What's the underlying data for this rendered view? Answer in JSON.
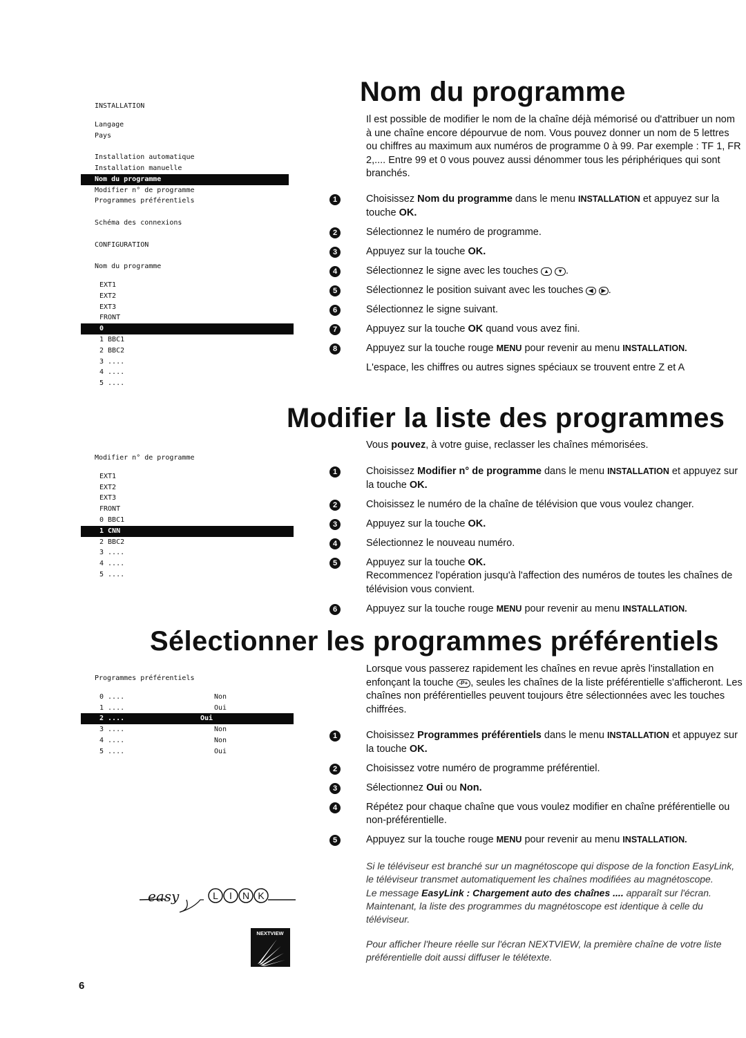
{
  "page_number": "6",
  "menus": [
    {
      "lines": [
        {
          "t": "INSTALLATION"
        },
        {
          "t": "Langage",
          "gap": "gap2"
        },
        {
          "t": "Pays"
        },
        {
          "t": "Installation automatique",
          "gap": "gap"
        },
        {
          "t": "Installation manuelle"
        },
        {
          "t": "Nom du programme",
          "hl": true
        },
        {
          "t": "Modifier n° de programme"
        },
        {
          "t": "Programmes préférentiels"
        },
        {
          "t": "Schéma des connexions",
          "gap": "gap"
        },
        {
          "t": "CONFIGURATION",
          "gap": "gap"
        },
        {
          "t": "Nom du programme",
          "gap": "gap"
        },
        {
          "t": "EXT1",
          "ind": true,
          "gap": "gap2"
        },
        {
          "t": "EXT2",
          "ind": true
        },
        {
          "t": "EXT3",
          "ind": true
        },
        {
          "t": "FRONT",
          "ind": true
        },
        {
          "t": "0",
          "ind": true,
          "hl": true
        },
        {
          "t": "1 BBC1",
          "ind": true
        },
        {
          "t": "2 BBC2",
          "ind": true
        },
        {
          "t": "3 ....",
          "ind": true
        },
        {
          "t": "4 ....",
          "ind": true
        },
        {
          "t": "5 ....",
          "ind": true
        }
      ]
    },
    {
      "lines": [
        {
          "t": "Modifier n° de programme"
        },
        {
          "t": "EXT1",
          "ind": true,
          "gap": "gap2"
        },
        {
          "t": "EXT2",
          "ind": true
        },
        {
          "t": "EXT3",
          "ind": true
        },
        {
          "t": "FRONT",
          "ind": true
        },
        {
          "t": "0 BBC1",
          "ind": true
        },
        {
          "t": "1 CNN",
          "ind": true,
          "hl": true
        },
        {
          "t": "2 BBC2",
          "ind": true
        },
        {
          "t": "3 ....",
          "ind": true
        },
        {
          "t": "4 ....",
          "ind": true
        },
        {
          "t": "5 ....",
          "ind": true
        }
      ]
    },
    {
      "lines": [
        {
          "t": "Programmes préférentiels"
        },
        {
          "t": "0 ....",
          "v": "Non",
          "ind": true,
          "gap": "gap2"
        },
        {
          "t": "1 ....",
          "v": "Oui",
          "ind": true
        },
        {
          "t": "2 ....",
          "v": "Oui",
          "ind": true,
          "hl": true
        },
        {
          "t": "3 ....",
          "v": "Non",
          "ind": true
        },
        {
          "t": "4 ....",
          "v": "Non",
          "ind": true
        },
        {
          "t": "5 ....",
          "v": "Oui",
          "ind": true
        }
      ]
    }
  ],
  "sections": [
    {
      "title": "Nom du programme",
      "intro": [
        [
          {
            "t": "Il est possible de modifier le nom de la chaîne déjà mémorisé ou d'attribuer un nom à une chaîne encore dépourvue de nom. Vous pouvez donner un nom de 5 lettres ou chiffres au maximum aux numéros de programme 0 à 99. Par exemple : TF 1, FR 2,.... Entre 99 et 0 vous pouvez aussi dénommer tous les périphériques qui sont branchés."
          }
        ]
      ],
      "steps": [
        {
          "n": "1",
          "s": [
            {
              "t": "Choisissez "
            },
            {
              "t": "Nom du programme",
              "c": "b"
            },
            {
              "t": "  dans le menu "
            },
            {
              "t": "INSTALLATION",
              "c": "sc"
            },
            {
              "t": " et appuyez sur la touche "
            },
            {
              "t": "OK.",
              "c": "b"
            }
          ]
        },
        {
          "n": "2",
          "s": [
            {
              "t": "Sélectionnez le numéro de  programme."
            }
          ]
        },
        {
          "n": "3",
          "s": [
            {
              "t": "Appuyez sur la touche "
            },
            {
              "t": "OK.",
              "c": "b"
            }
          ]
        },
        {
          "n": "4",
          "s": [
            {
              "t": "Sélectionnez le signe avec les touches "
            },
            {
              "k": "▲",
              "icon": "cursor-up-key-icon"
            },
            {
              "t": " "
            },
            {
              "k": "▼",
              "icon": "cursor-down-key-icon"
            },
            {
              "t": "."
            }
          ]
        },
        {
          "n": "5",
          "s": [
            {
              "t": "Sélectionnez le position suivant avec les touches "
            },
            {
              "k": "◀",
              "icon": "cursor-left-key-icon"
            },
            {
              "t": " "
            },
            {
              "k": "▶",
              "icon": "cursor-right-key-icon"
            },
            {
              "t": "."
            }
          ]
        },
        {
          "n": "6",
          "s": [
            {
              "t": "Sélectionnez le signe suivant."
            }
          ]
        },
        {
          "n": "7",
          "s": [
            {
              "t": "Appuyez sur la touche "
            },
            {
              "t": "OK",
              "c": "b"
            },
            {
              "t": " quand vous avez fini."
            }
          ]
        },
        {
          "n": "8",
          "s": [
            {
              "t": "Appuyez sur la touche rouge "
            },
            {
              "t": "MENU",
              "c": "sc"
            },
            {
              "t": " pour revenir au menu "
            },
            {
              "t": "INSTALLATION.",
              "c": "sc"
            }
          ]
        },
        {
          "n": "",
          "s": [
            {
              "t": "L'espace, les chiffres ou autres signes spéciaux se trouvent entre Z et A"
            }
          ]
        }
      ],
      "notes": []
    },
    {
      "title": "Modifier la liste des programmes",
      "intro": [
        [
          {
            "t": "Vous "
          },
          {
            "t": "pouvez",
            "c": "b"
          },
          {
            "t": ", à votre guise, reclasser les chaînes mémorisées."
          }
        ]
      ],
      "steps": [
        {
          "n": "1",
          "s": [
            {
              "t": "Choisissez "
            },
            {
              "t": "Modifier n° de programme",
              "c": "b"
            },
            {
              "t": " dans le menu "
            },
            {
              "t": "INSTALLATION",
              "c": "sc"
            },
            {
              "t": " et appuyez sur la touche "
            },
            {
              "t": "OK.",
              "c": "b"
            }
          ]
        },
        {
          "n": "2",
          "s": [
            {
              "t": "Choisissez le numéro de la chaîne de télévision que vous voulez changer."
            }
          ]
        },
        {
          "n": "3",
          "s": [
            {
              "t": "Appuyez sur la touche "
            },
            {
              "t": "OK.",
              "c": "b"
            }
          ]
        },
        {
          "n": "4",
          "s": [
            {
              "t": "Sélectionnez le nouveau numéro."
            }
          ]
        },
        {
          "n": "5",
          "s": [
            {
              "t": "Appuyez sur la touche "
            },
            {
              "t": "OK.",
              "c": "b"
            },
            {
              "t": "\nRecommencez l'opération jusqu'à l'affection des numéros de toutes les chaînes de télévision vous convient."
            }
          ]
        },
        {
          "n": "6",
          "s": [
            {
              "t": "Appuyez sur la touche rouge "
            },
            {
              "t": "MENU",
              "c": "sc"
            },
            {
              "t": " pour revenir au menu "
            },
            {
              "t": "INSTALLATION.",
              "c": "sc"
            }
          ]
        }
      ],
      "notes": []
    },
    {
      "title": "Sélectionner les programmes préférentiels",
      "intro": [
        [
          {
            "t": "Lorsque vous passerez rapidement les chaînes en revue après l'installation en enfonçant la touche "
          },
          {
            "k": "-P+",
            "icon": "program-plus-minus-key-icon"
          },
          {
            "t": ", seules les chaînes de la liste préférentielle s'afficheront. Les chaînes non préférentielles peuvent toujours être sélectionnées avec les touches chiffrées."
          }
        ]
      ],
      "steps": [
        {
          "n": "1",
          "s": [
            {
              "t": "Choisissez "
            },
            {
              "t": "Programmes préférentiels",
              "c": "b"
            },
            {
              "t": " dans le menu "
            },
            {
              "t": "INSTALLATION",
              "c": "sc"
            },
            {
              "t": " et appuyez sur la touche "
            },
            {
              "t": "OK.",
              "c": "b"
            }
          ]
        },
        {
          "n": "2",
          "s": [
            {
              "t": "Choisissez votre numéro de programme préférentiel."
            }
          ]
        },
        {
          "n": "3",
          "s": [
            {
              "t": "Sélectionnez "
            },
            {
              "t": "Oui",
              "c": "b"
            },
            {
              "t": " ou "
            },
            {
              "t": "Non.",
              "c": "b"
            }
          ]
        },
        {
          "n": "4",
          "s": [
            {
              "t": "Répétez pour chaque chaîne que vous voulez modifier en chaîne préférentielle ou non-préférentielle."
            }
          ]
        },
        {
          "n": "5",
          "s": [
            {
              "t": "Appuyez sur la touche rouge "
            },
            {
              "t": "MENU",
              "c": "sc"
            },
            {
              "t": " pour revenir au menu "
            },
            {
              "t": "INSTALLATION.",
              "c": "sc"
            }
          ]
        }
      ],
      "notes": [
        [
          {
            "t": "Si le téléviseur est branché sur un magnétoscope qui dispose de la fonction EasyLink, le téléviseur transmet automatiquement les chaînes modifiées au magnétoscope.\nLe message "
          },
          {
            "t": "EasyLink : Chargement auto des chaînes ....",
            "c": "b"
          },
          {
            "t": " apparaît sur l'écran. Maintenant, la liste des programmes du magnétoscope est identique à celle du téléviseur."
          }
        ],
        [
          {
            "t": "Pour afficher l'heure réelle sur l'écran NEXTVIEW, la première chaîne de votre liste préférentielle doit aussi diffuser le télétexte."
          }
        ]
      ]
    }
  ],
  "logos": {
    "easylink": "easy LINK",
    "nextview": "NEXTVIEW"
  }
}
